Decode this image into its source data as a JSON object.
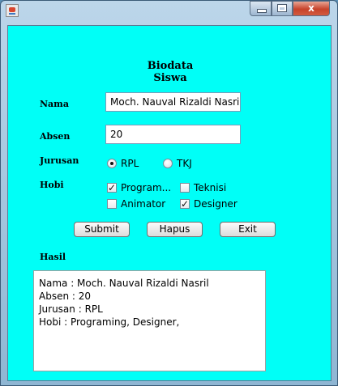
{
  "window": {
    "controls": {
      "minimize": "minimize",
      "maximize": "maximize",
      "close": "close"
    },
    "close_glyph": "x"
  },
  "form": {
    "title": "Biodata Siswa",
    "nama_label": "Nama",
    "nama_value": "Moch. Nauval Rizaldi Nasril",
    "absen_label": "Absen",
    "absen_value": "20",
    "jurusan_label": "Jurusan",
    "jurusan_options": [
      {
        "label": "RPL",
        "selected": true
      },
      {
        "label": "TKJ",
        "selected": false
      }
    ],
    "hobi_label": "Hobi",
    "hobi_options": [
      {
        "label": "Program...",
        "checked": true
      },
      {
        "label": "Teknisi",
        "checked": false
      },
      {
        "label": "Animator",
        "checked": false
      },
      {
        "label": "Designer",
        "checked": true
      }
    ],
    "check_glyph": "✓",
    "buttons": {
      "submit": "Submit",
      "hapus": "Hapus",
      "exit": "Exit"
    },
    "hasil_label": "Hasil",
    "hasil_lines": [
      "Nama : Moch. Nauval Rizaldi Nasril",
      "Absen : 20",
      "Jurusan : RPL",
      "Hobi : Programing, Designer,"
    ]
  },
  "colors": {
    "content_bg": "#00fff7",
    "title_bar": "#8fb6d3",
    "close_button": "#c7432b"
  }
}
